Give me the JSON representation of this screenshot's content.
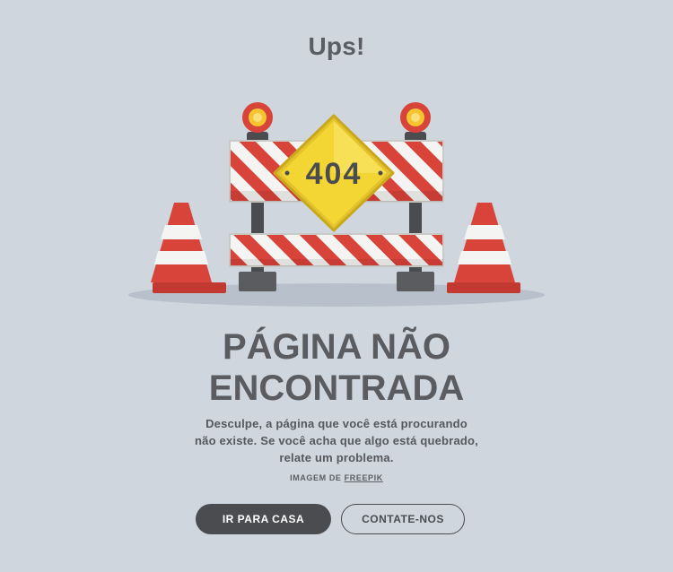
{
  "heading": "Ups!",
  "sign_text": "404",
  "title_line1": "PÁGINA NÃO",
  "title_line2": "ENCONTRADA",
  "description_lines": [
    "Desculpe, a página que você está procurando",
    "não existe. Se você acha que algo está quebrado,",
    "relate um problema."
  ],
  "credit": {
    "prefix": "IMAGEM DE ",
    "link_label": "FREEPIK"
  },
  "buttons": {
    "home_label": "IR PARA CASA",
    "contact_label": "CONTATE-NOS"
  },
  "icons": {
    "illustration": "road-barrier-404-illustration",
    "cone": "traffic-cone-icon",
    "lamp": "warning-lamp-icon"
  },
  "colors": {
    "background": "#cfd6de",
    "primary_button": "#4a4c50",
    "barrier_red": "#d8433a",
    "sign_yellow": "#f3d534"
  }
}
